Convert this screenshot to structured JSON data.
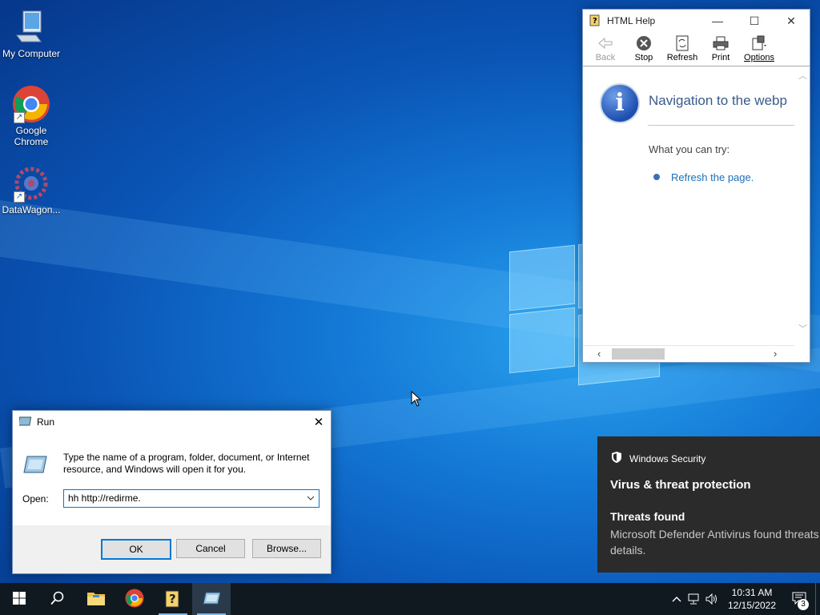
{
  "desktop": {
    "icons": [
      {
        "label": "My Computer",
        "icon": "computer-icon"
      },
      {
        "label": "Google Chrome",
        "icon": "chrome-icon"
      },
      {
        "label": "DataWagon...",
        "icon": "datawagon-icon"
      }
    ]
  },
  "help_window": {
    "title": "HTML Help",
    "toolbar": [
      {
        "label": "Back",
        "icon": "back-arrow-icon",
        "enabled": false
      },
      {
        "label": "Stop",
        "icon": "stop-icon",
        "enabled": true
      },
      {
        "label": "Refresh",
        "icon": "refresh-icon",
        "enabled": true
      },
      {
        "label": "Print",
        "icon": "printer-icon",
        "enabled": true
      },
      {
        "label": "Options",
        "icon": "options-icon",
        "enabled": true
      }
    ],
    "content": {
      "heading": "Navigation to the webp",
      "try_heading": "What you can try:",
      "link": "Refresh the page."
    }
  },
  "run_dialog": {
    "title": "Run",
    "description": "Type the name of a program, folder, document, or Internet resource, and Windows will open it for you.",
    "open_label": "Open:",
    "open_value": "hh http://redirme.",
    "buttons": {
      "ok": "OK",
      "cancel": "Cancel",
      "browse": "Browse..."
    }
  },
  "toast": {
    "app": "Windows Security",
    "heading": "Virus & threat protection",
    "subheading": "Threats found",
    "message": "Microsoft Defender Antivirus found threats. Get details."
  },
  "taskbar": {
    "apps": [
      {
        "name": "start",
        "icon": "windows-start-icon"
      },
      {
        "name": "search",
        "icon": "search-icon"
      },
      {
        "name": "file-explorer",
        "icon": "folder-icon"
      },
      {
        "name": "chrome",
        "icon": "chrome-icon"
      },
      {
        "name": "html-help",
        "icon": "help-book-icon"
      },
      {
        "name": "run",
        "icon": "run-icon"
      }
    ],
    "time": "10:31 AM",
    "date": "12/15/2022",
    "notification_count": "3"
  },
  "colors": {
    "accent": "#0078d7",
    "toast_bg": "#2b2b2b",
    "taskbar_bg": "#101820"
  }
}
